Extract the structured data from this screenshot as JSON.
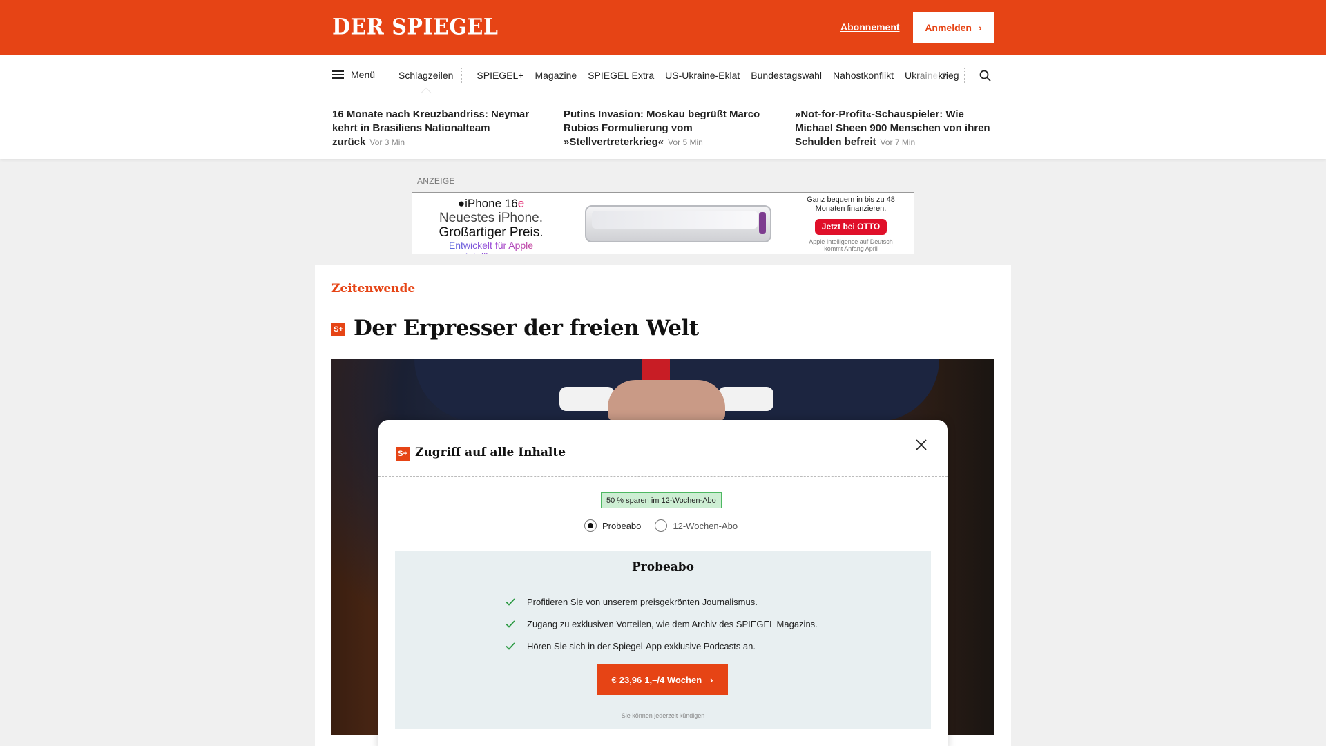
{
  "header": {
    "logo": "DER SPIEGEL",
    "subscription_link": "Abonnement",
    "login_button": "Anmelden",
    "brand_color": "#e64415"
  },
  "nav": {
    "menu_label": "Menü",
    "items": [
      "Schlagzeilen",
      "SPIEGEL+",
      "Magazine",
      "SPIEGEL Extra",
      "US-Ukraine-Eklat",
      "Bundestagswahl",
      "Nahostkonflikt",
      "Ukrainekrieg"
    ],
    "active": "Schlagzeilen"
  },
  "headlines": [
    {
      "title": "16 Monate nach Kreuzbandriss: Neymar kehrt in Brasiliens Nationalteam zurück",
      "time": "Vor 3 Min"
    },
    {
      "title": "Putins Invasion: Moskau begrüßt Marco Rubios Formulierung vom »Stellvertreterkrieg«",
      "time": "Vor 5 Min"
    },
    {
      "title": "»Not-for-Profit«-Schauspieler: Wie Michael Sheen 900 Menschen von ihren Schulden befreit",
      "time": "Vor 7 Min"
    }
  ],
  "ad": {
    "label": "ANZEIGE",
    "model_prefix": "iPhone 16",
    "model_suffix": "e",
    "line1": "Neuestes iPhone.",
    "line2": "Großartiger Preis.",
    "ai_line": "Entwickelt für Apple Intelligence.",
    "finance_text": "Ganz bequem in bis zu 48 Monaten finanzieren.",
    "button": "Jetzt bei OTTO",
    "note": "Apple Intelligence auf Deutsch kommt Anfang April"
  },
  "article": {
    "kicker": "Zeitenwende",
    "badge": "S+",
    "title": "Der Erpresser der freien Welt"
  },
  "modal": {
    "badge": "S+",
    "title": "Zugriff auf alle Inhalte",
    "save_badge": "50 % sparen im 12-Wochen-Abo",
    "options": [
      {
        "label": "Probeabo",
        "selected": true
      },
      {
        "label": "12-Wochen-Abo",
        "selected": false
      }
    ],
    "plan_title": "Probeabo",
    "features": [
      "Profitieren Sie von unserem preisgekrönten Journalismus.",
      "Zugang zu exklusiven Vorteilen, wie dem Archiv des SPIEGEL Magazins.",
      "Hören Sie sich in der Spiegel-App exklusive Podcasts an."
    ],
    "cta_currency": "€",
    "cta_old_price": "23,96",
    "cta_new_price": "1,–/4 Wochen",
    "cancel_note": "Sie können jederzeit kündigen",
    "check_color": "#2e9b45"
  }
}
